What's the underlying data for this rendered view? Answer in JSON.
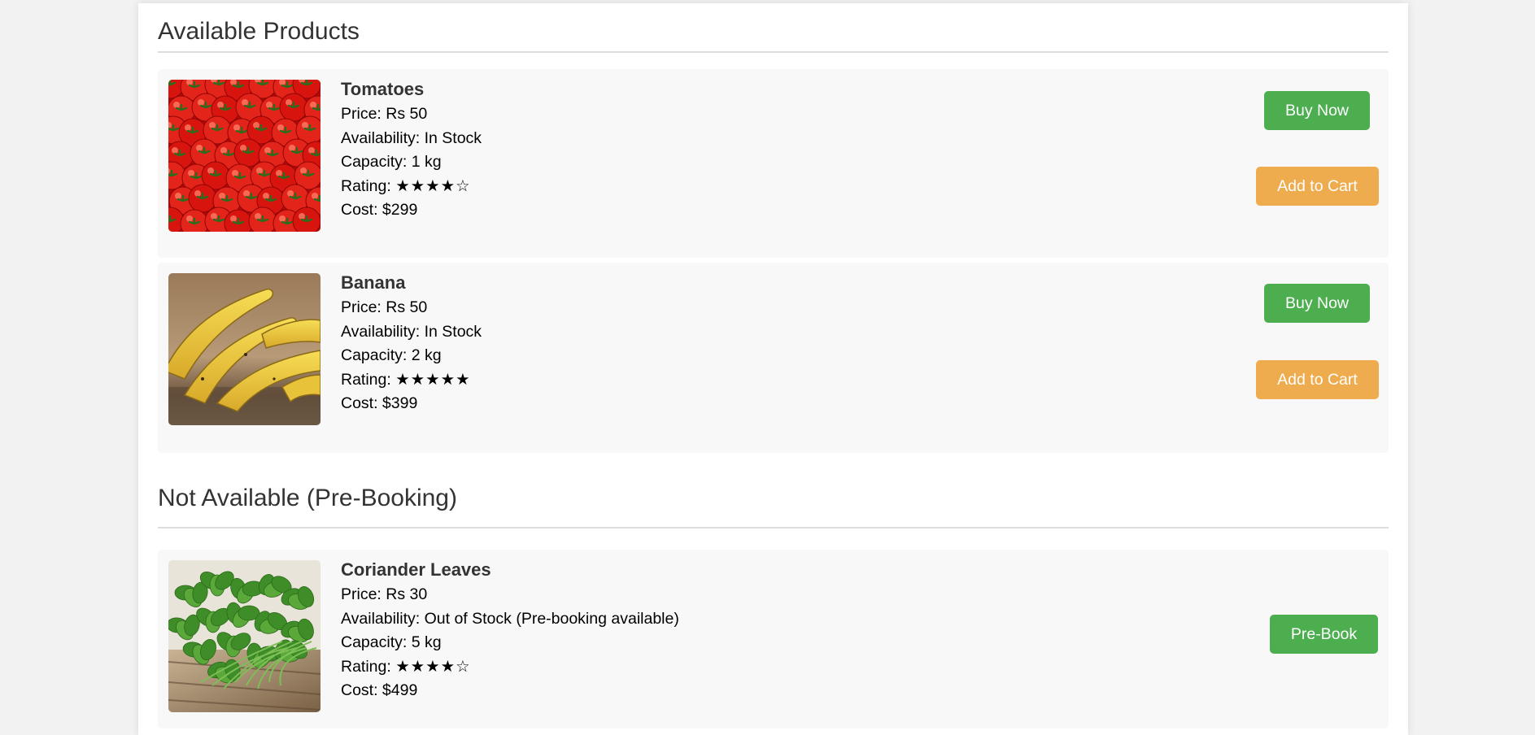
{
  "sections": {
    "available": {
      "title": "Available Products",
      "products": [
        {
          "image_icon": "tomatoes-photo",
          "name": "Tomatoes",
          "price": "Price: Rs 50",
          "availability": "Availability: In Stock",
          "capacity": "Capacity: 1 kg",
          "rating_label": "Rating: ",
          "rating_stars": "★★★★☆",
          "rating_value": 4,
          "cost": "Cost: $299",
          "buy_label": "Buy Now",
          "cart_label": "Add to Cart"
        },
        {
          "image_icon": "banana-photo",
          "name": "Banana",
          "price": "Price: Rs 50",
          "availability": "Availability: In Stock",
          "capacity": "Capacity: 2 kg",
          "rating_label": "Rating: ",
          "rating_stars": "★★★★★",
          "rating_value": 5,
          "cost": "Cost: $399",
          "buy_label": "Buy Now",
          "cart_label": "Add to Cart"
        }
      ]
    },
    "prebooking": {
      "title": "Not Available (Pre-Booking)",
      "products": [
        {
          "image_icon": "coriander-photo",
          "name": "Coriander Leaves",
          "price": "Price: Rs 30",
          "availability": "Availability: Out of Stock (Pre-booking available)",
          "capacity": "Capacity: 5 kg",
          "rating_label": "Rating: ",
          "rating_stars": "★★★★☆",
          "rating_value": 4,
          "cost": "Cost: $499",
          "prebook_label": "Pre-Book"
        }
      ]
    }
  },
  "colors": {
    "buy_button": "#4cae4f",
    "cart_button": "#efac4e",
    "card_background": "#f8f8f8",
    "heading_text": "#333333"
  }
}
